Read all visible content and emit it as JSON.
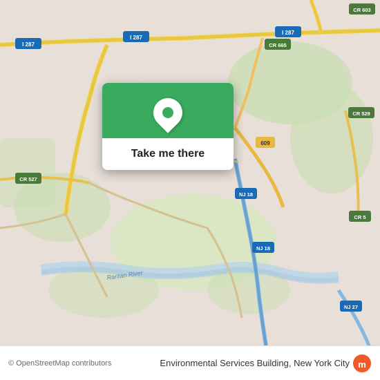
{
  "map": {
    "attribution": "© OpenStreetMap contributors",
    "bg_color": "#e8e0d8"
  },
  "popup": {
    "button_label": "Take me there",
    "icon_color": "#3aaa5e"
  },
  "bottom_bar": {
    "location_text": "Environmental Services Building, New York City",
    "moovit_label": "moovit"
  },
  "road_labels": [
    "I 287",
    "I 287",
    "I 287",
    "CR 603",
    "CR 665",
    "CR 529",
    "609",
    "NJ 18",
    "NJ 18",
    "CR 527",
    "Raritan River",
    "NJ 27",
    "CR 5"
  ]
}
